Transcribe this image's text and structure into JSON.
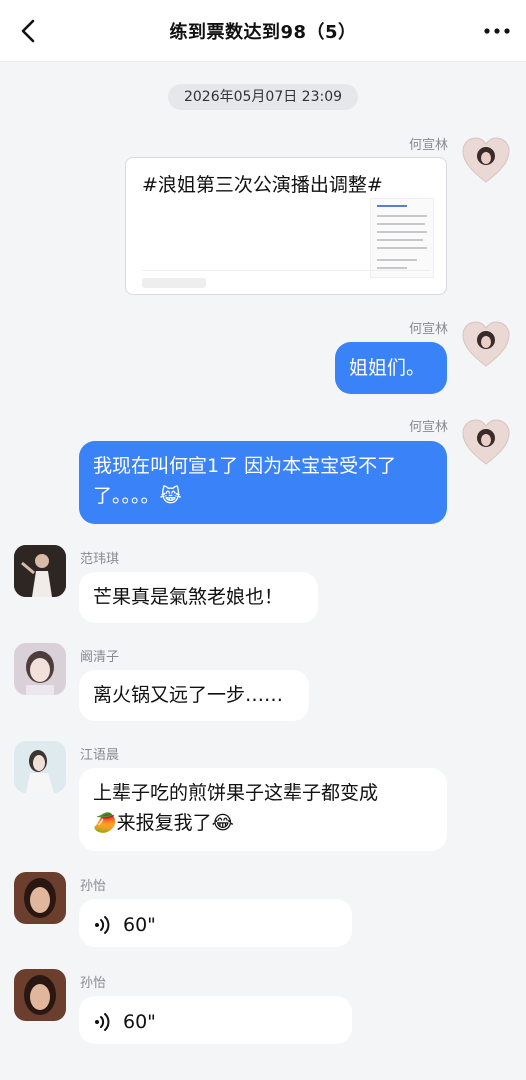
{
  "header": {
    "title": "练到票数达到98（5）",
    "back_icon": "chevron-left-icon",
    "more_icon": "more-horizontal-icon"
  },
  "timestamp": "2026年05月07日 23:09",
  "messages": [
    {
      "sender": "何宣林",
      "type": "card",
      "card_title": "#浪姐第三次公演播出调整#"
    },
    {
      "sender": "何宣林",
      "type": "text",
      "text": "姐姐们。"
    },
    {
      "sender": "何宣林",
      "type": "text",
      "text_line1": "我现在叫何宣1了 因为本宝宝受不了",
      "text_line2": "了。。。。😹"
    },
    {
      "sender": "范玮琪",
      "type": "text",
      "text": "芒果真是氣煞老娘也！"
    },
    {
      "sender": "阚清子",
      "type": "text",
      "text": "离火锅又远了一步……"
    },
    {
      "sender": "江语晨",
      "type": "text",
      "text_line1": "上辈子吃的煎饼果子这辈子都变成",
      "text_line2": "🥭来报复我了😂"
    },
    {
      "sender": "孙怡",
      "type": "voice",
      "duration": "60\""
    },
    {
      "sender": "孙怡",
      "type": "voice",
      "duration": "60\""
    }
  ],
  "colors": {
    "accent_blue": "#3a82f7",
    "background": "#f4f5f7",
    "bubble_white": "#ffffff"
  }
}
